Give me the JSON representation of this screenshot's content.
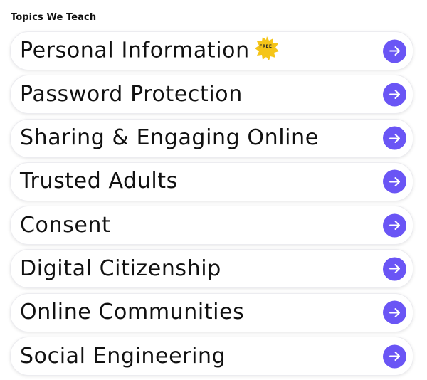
{
  "section": {
    "title": "Topics We Teach"
  },
  "colors": {
    "accent": "#6a55f5",
    "badge": "#f5c518",
    "card_border": "#ececf0"
  },
  "topics": [
    {
      "label": "Personal Information",
      "badge": "FREE!"
    },
    {
      "label": "Password Protection"
    },
    {
      "label": "Sharing & Engaging Online"
    },
    {
      "label": "Trusted Adults"
    },
    {
      "label": "Consent"
    },
    {
      "label": "Digital Citizenship"
    },
    {
      "label": "Online Communities"
    },
    {
      "label": "Social Engineering"
    }
  ],
  "icons": {
    "arrow": "arrow-right-icon",
    "badge": "starburst-badge-icon"
  }
}
